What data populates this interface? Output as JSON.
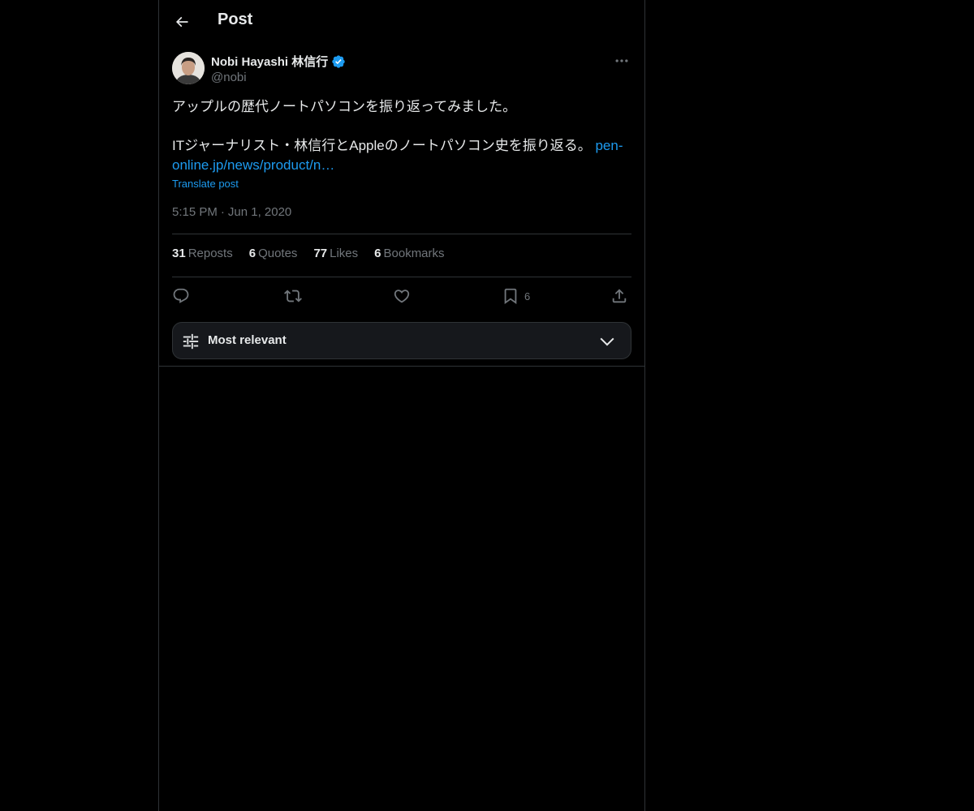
{
  "header": {
    "title": "Post",
    "back_icon": "arrow-left-icon"
  },
  "post": {
    "author": {
      "name": "Nobi Hayashi 林信行",
      "handle": "@nobi",
      "verified": true
    },
    "text_line1": "アップルの歴代ノートパソコンを振り返ってみました。",
    "text_line2": "ITジャーナリスト・林信行とAppleのノートパソコン史を振り返る。 ",
    "link_text": "pen-online.jp/news/product/n…",
    "translate_label": "Translate post",
    "time": "5:15 PM",
    "date": "Jun 1, 2020",
    "stats": [
      {
        "count": "31",
        "label": "Reposts"
      },
      {
        "count": "6",
        "label": "Quotes"
      },
      {
        "count": "77",
        "label": "Likes"
      },
      {
        "count": "6",
        "label": "Bookmarks"
      }
    ],
    "actions": {
      "reply_icon": "reply-icon",
      "repost_icon": "repost-icon",
      "like_icon": "heart-icon",
      "bookmark_icon": "bookmark-icon",
      "bookmark_count": "6",
      "share_icon": "share-icon"
    }
  },
  "replies_sort": {
    "label": "Most relevant",
    "icon": "sliders-icon",
    "chevron": "chevron-down-icon"
  },
  "colors": {
    "background": "#000000",
    "text": "#e7e9ea",
    "muted": "#71767b",
    "accent": "#1d9bf0",
    "border": "#2f3336"
  }
}
